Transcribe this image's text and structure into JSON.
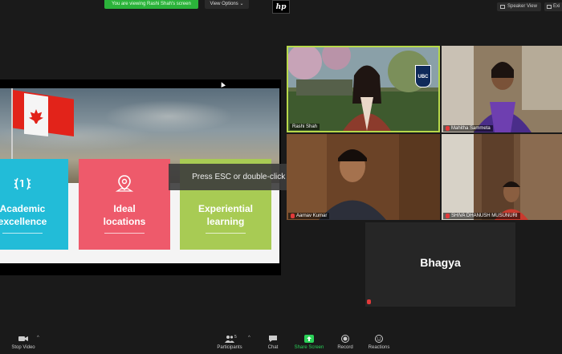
{
  "topbar": {
    "viewing_banner": "You are viewing Rashi Shah's screen",
    "view_options": "View Options",
    "view_options_caret": "⌄",
    "hp_logo": "hp",
    "speaker_view": "Speaker View",
    "exit_label": "Exi"
  },
  "slide": {
    "cards": [
      {
        "line1": "Academic",
        "line2": "excellence",
        "color": "#22bcd8",
        "icon": "laurel-icon"
      },
      {
        "line1": "Ideal",
        "line2": "locations",
        "color": "#ee5a6b",
        "icon": "map-pin-icon"
      },
      {
        "line1": "Experiential",
        "line2": "learning",
        "color": "#a8cb54",
        "icon": "none"
      }
    ],
    "logo": "UBC"
  },
  "overlay": {
    "esc_message": "Press ESC or double-click to exit full screen mode"
  },
  "participants": [
    {
      "name": "Rashi Shah",
      "active_speaker": true
    },
    {
      "name": "Mahitha Sammeta",
      "muted": true
    },
    {
      "name": "Aarnav Kumar",
      "muted": true
    },
    {
      "name": "SHIVA DHANUSH MUSUNURI",
      "muted": true
    },
    {
      "name": "Bhagya",
      "muted": true,
      "video_off": true
    }
  ],
  "toolbar": {
    "stop_video": "Stop Video",
    "participants": "Participants",
    "participants_count": "5",
    "chat": "Chat",
    "share_screen": "Share Screen",
    "record": "Record",
    "reactions": "Reactions",
    "caret": "^",
    "share_color": "#2bd158"
  }
}
